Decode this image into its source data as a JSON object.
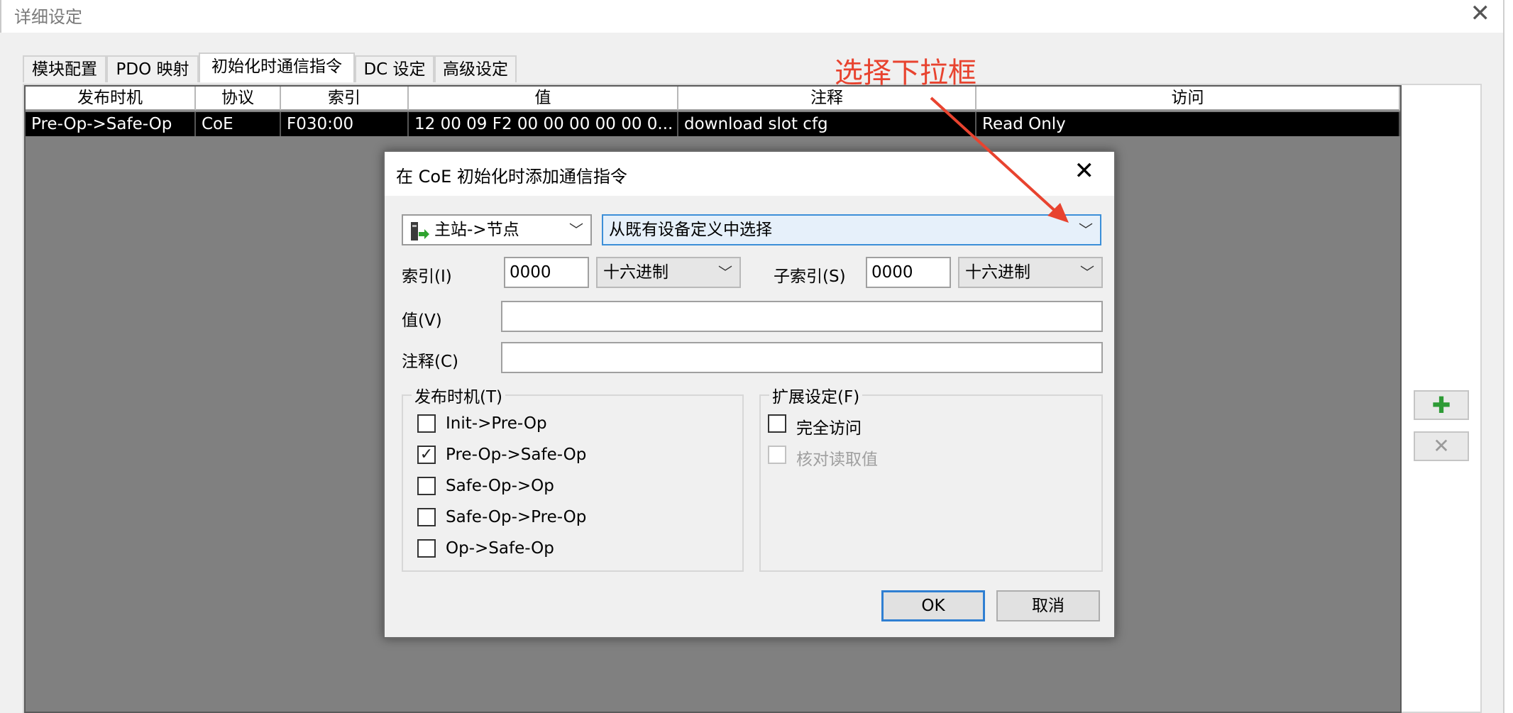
{
  "window": {
    "title": "详细设定",
    "close_glyph": "✕"
  },
  "tabs": [
    {
      "label": "模块配置"
    },
    {
      "label": "PDO 映射"
    },
    {
      "label": "初始化时通信指令"
    },
    {
      "label": "DC 设定"
    },
    {
      "label": "高级设定"
    }
  ],
  "table": {
    "columns": [
      "发布时机",
      "协议",
      "索引",
      "值",
      "注释",
      "访问"
    ],
    "rows": [
      [
        "Pre-Op->Safe-Op",
        "CoE",
        "F030:00",
        "12 00 09 F2 00 00 00 00 00 0...",
        "download slot cfg",
        "Read Only"
      ]
    ]
  },
  "side_buttons": {
    "add_glyph": "✚",
    "remove_glyph": "✕",
    "add_color": "#2e9b36",
    "remove_color": "#9a9a9a"
  },
  "annotation": {
    "text": "选择下拉框",
    "color": "#e8432f"
  },
  "dialog": {
    "title": "在 CoE 初始化时添加通信指令",
    "close_glyph": "✕",
    "direction_combo": {
      "icon": "master-to-node-icon",
      "value": "主站->节点"
    },
    "definition_combo": {
      "value": "从既有设备定义中选择"
    },
    "index": {
      "label": "索引(I)",
      "value": "0000",
      "format": "十六进制"
    },
    "subindex": {
      "label": "子索引(S)",
      "value": "0000",
      "format": "十六进制"
    },
    "value_field": {
      "label": "值(V)",
      "value": ""
    },
    "comment_field": {
      "label": "注释(C)",
      "value": ""
    },
    "timing_group": {
      "title": "发布时机(T)",
      "options": [
        {
          "label": "Init->Pre-Op",
          "checked": false
        },
        {
          "label": "Pre-Op->Safe-Op",
          "checked": true
        },
        {
          "label": "Safe-Op->Op",
          "checked": false
        },
        {
          "label": "Safe-Op->Pre-Op",
          "checked": false
        },
        {
          "label": "Op->Safe-Op",
          "checked": false
        }
      ]
    },
    "ext_group": {
      "title": "扩展设定(F)",
      "options": [
        {
          "label": "完全访问",
          "checked": false,
          "enabled": true
        },
        {
          "label": "核对读取值",
          "checked": false,
          "enabled": false
        }
      ]
    },
    "ok_label": "OK",
    "cancel_label": "取消",
    "chevron": "﹀",
    "check_glyph": "✓"
  }
}
